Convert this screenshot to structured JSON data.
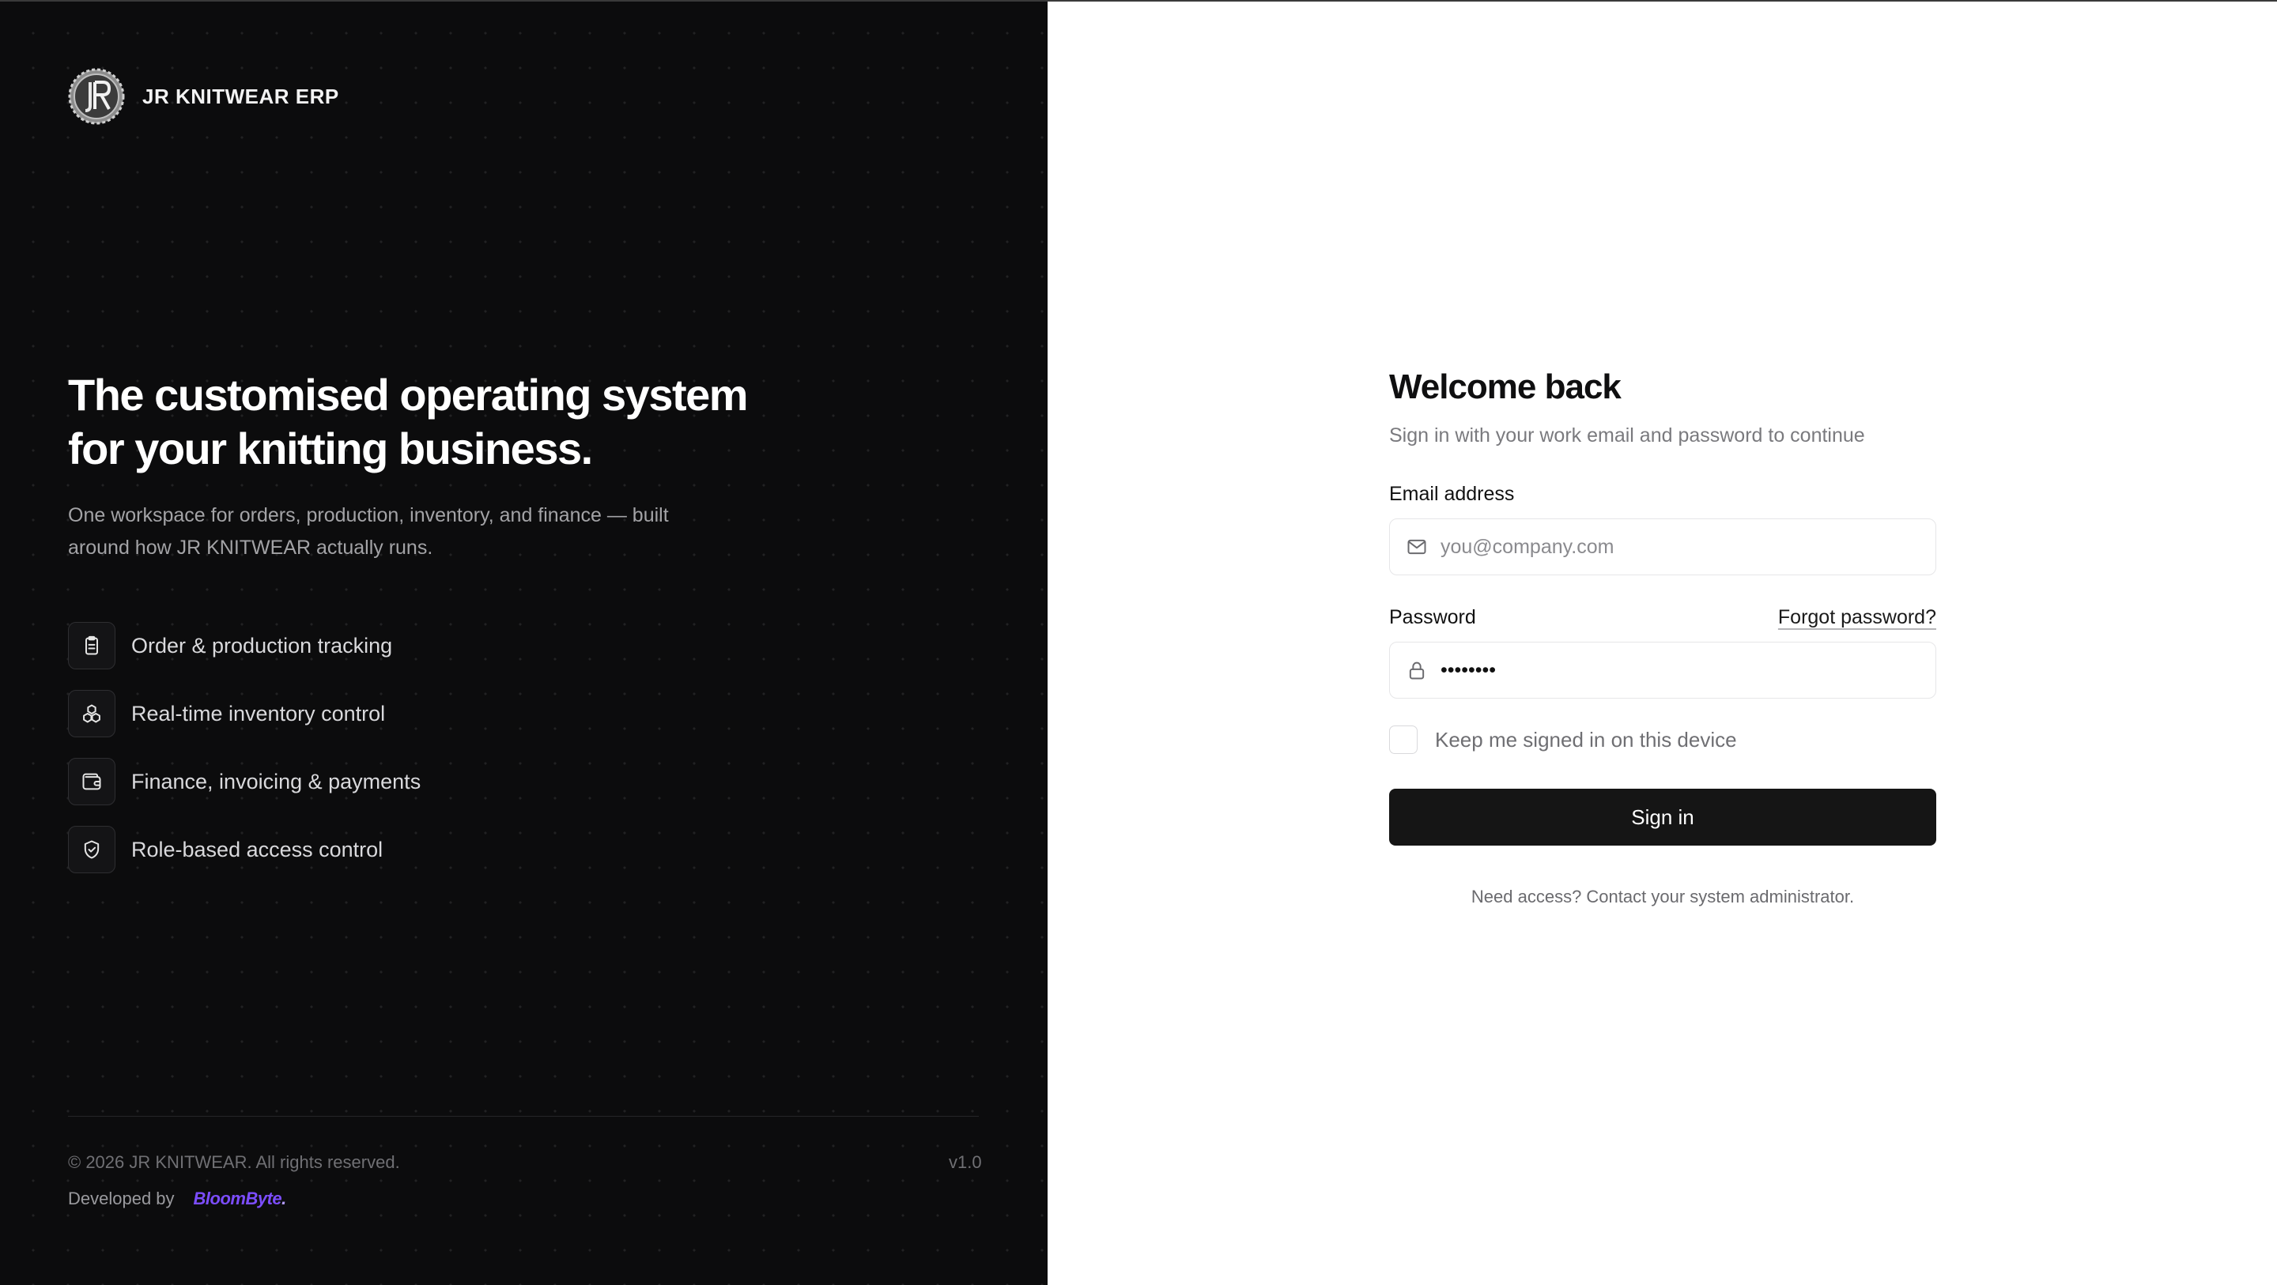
{
  "brand": {
    "name": "JR KNITWEAR ERP",
    "logo_icon": "jr-monogram-gear-logo"
  },
  "hero": {
    "headline": "The customised operating system for your knitting business.",
    "subtext": "One workspace for orders, production, inventory, and finance — built around how JR KNITWEAR actually runs."
  },
  "features": [
    {
      "label": "Order & production tracking",
      "icon": "clipboard-icon"
    },
    {
      "label": "Real-time inventory control",
      "icon": "boxes-icon"
    },
    {
      "label": "Finance, invoicing & payments",
      "icon": "wallet-icon"
    },
    {
      "label": "Role-based access control",
      "icon": "shield-check-icon"
    }
  ],
  "footer": {
    "copyright": "© 2026 JR KNITWEAR. All rights reserved.",
    "version": "v1.0",
    "developed_by_label": "Developed by",
    "developer": "BloomByte",
    "developer_suffix": "."
  },
  "login": {
    "title": "Welcome back",
    "subtitle": "Sign in with your work email and password to continue",
    "email_label": "Email address",
    "email_placeholder": "you@company.com",
    "email_value": "",
    "password_label": "Password",
    "password_value": "••••••••",
    "forgot_label": "Forgot password?",
    "remember_label": "Keep me signed in on this device",
    "remember_checked": false,
    "signin_label": "Sign in",
    "help_text": "Need access? Contact your system administrator."
  },
  "colors": {
    "left_bg": "#0c0c0d",
    "button_bg": "#151515",
    "developer_brand": "#7c4dff"
  }
}
